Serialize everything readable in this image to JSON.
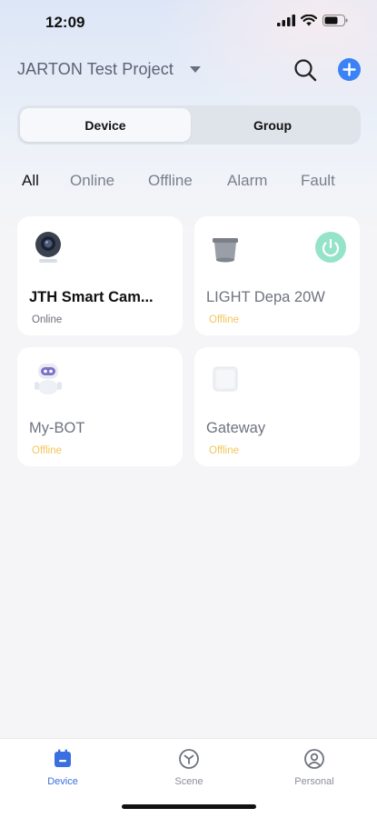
{
  "status_bar": {
    "time": "12:09",
    "icons": [
      "signal-icon",
      "wifi-icon",
      "battery-icon"
    ]
  },
  "header": {
    "project_title": "JARTON Test Project",
    "icons": [
      "chevron-down-icon",
      "search-icon",
      "add-icon"
    ]
  },
  "segment": {
    "tabs": [
      {
        "label": "Device",
        "active": true
      },
      {
        "label": "Group",
        "active": false
      }
    ]
  },
  "filters": [
    {
      "label": "All",
      "active": true
    },
    {
      "label": "Online",
      "active": false
    },
    {
      "label": "Offline",
      "active": false
    },
    {
      "label": "Alarm",
      "active": false
    },
    {
      "label": "Fault",
      "active": false
    }
  ],
  "devices": [
    {
      "name": "JTH Smart Cam...",
      "status": "Online",
      "icon": "camera-icon"
    },
    {
      "name": "LIGHT Depa 20W",
      "status": "Offline",
      "icon": "ceiling-light-icon",
      "has_power_button": true
    },
    {
      "name": "My-BOT",
      "status": "Offline",
      "icon": "robot-icon"
    },
    {
      "name": "Gateway",
      "status": "Offline",
      "icon": "gateway-icon"
    }
  ],
  "bottom_nav": [
    {
      "label": "Device",
      "icon": "device-icon",
      "active": true
    },
    {
      "label": "Scene",
      "icon": "scene-icon",
      "active": false
    },
    {
      "label": "Personal",
      "icon": "person-icon",
      "active": false
    }
  ],
  "colors": {
    "accent_blue": "#3b82f6",
    "offline_yellow": "#f3c55b",
    "power_green": "#95e3c8"
  }
}
